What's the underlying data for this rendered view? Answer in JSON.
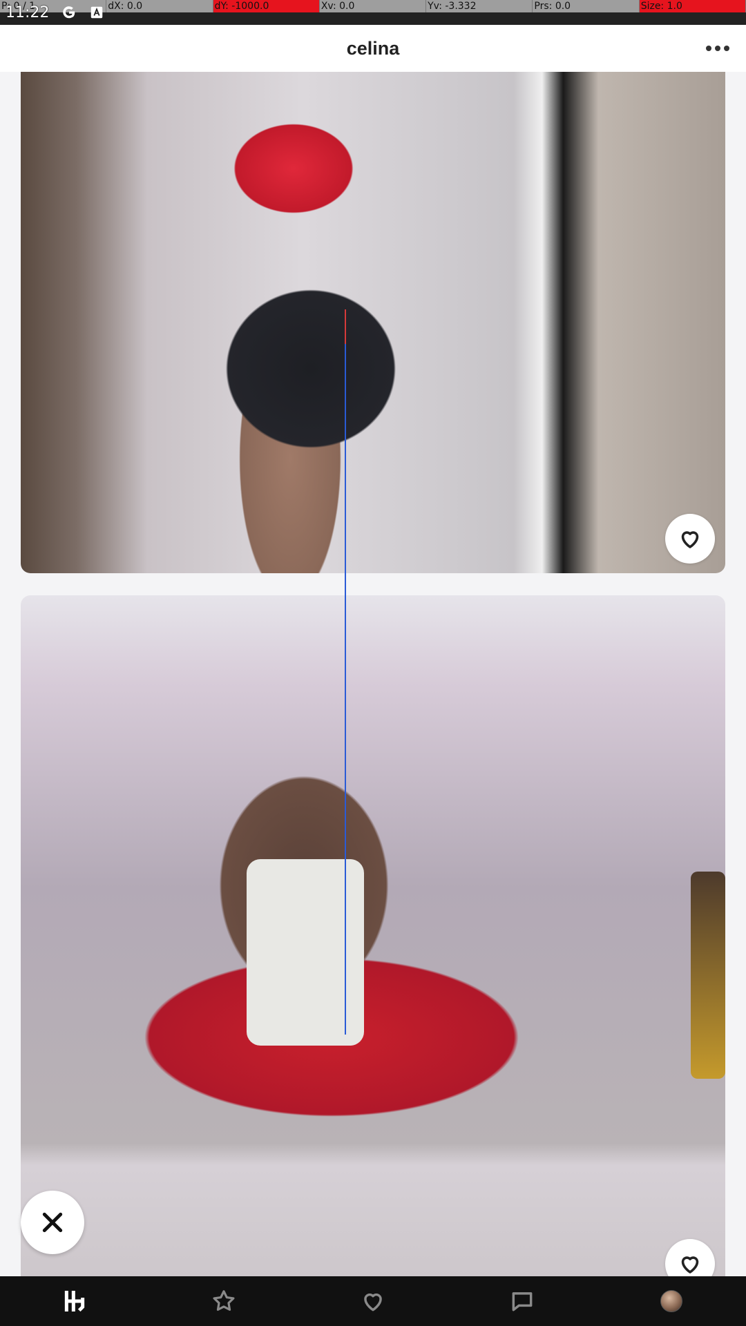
{
  "debug_bar": {
    "p": "P: 0 / 1",
    "dx": "dX: 0.0",
    "dy": "dY: -1000.0",
    "xv": "Xv: 0.0",
    "yv": "Yv: -3.332",
    "prs": "Prs: 0.0",
    "size": "Size: 1.0"
  },
  "status_bar": {
    "time": "11:22",
    "icons": [
      "google-icon",
      "font-icon"
    ]
  },
  "header": {
    "title": "celina",
    "more_icon": "more-horizontal-icon"
  },
  "photos": [
    {
      "icon": "heart-icon"
    },
    {
      "icon": "heart-icon"
    }
  ],
  "fab": {
    "icon": "close-icon"
  },
  "bottom_nav": {
    "items": [
      "home-icon",
      "star-icon",
      "heart-icon",
      "chat-icon",
      "avatar"
    ],
    "active": "home-icon"
  },
  "colors": {
    "debug_alert": "#e6141e",
    "nav_bg": "#111111",
    "header_bg": "#ffffff"
  }
}
